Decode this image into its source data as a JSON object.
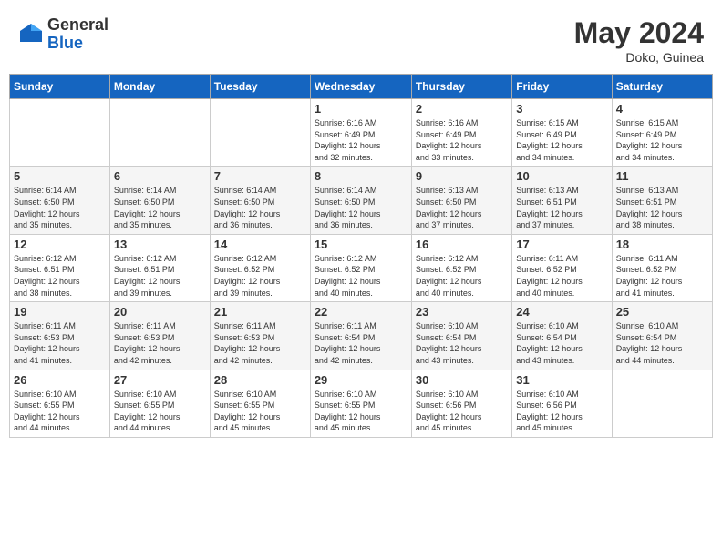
{
  "logo": {
    "general": "General",
    "blue": "Blue"
  },
  "title": {
    "month_year": "May 2024",
    "location": "Doko, Guinea"
  },
  "headers": [
    "Sunday",
    "Monday",
    "Tuesday",
    "Wednesday",
    "Thursday",
    "Friday",
    "Saturday"
  ],
  "weeks": [
    [
      {
        "day": "",
        "info": ""
      },
      {
        "day": "",
        "info": ""
      },
      {
        "day": "",
        "info": ""
      },
      {
        "day": "1",
        "info": "Sunrise: 6:16 AM\nSunset: 6:49 PM\nDaylight: 12 hours\nand 32 minutes."
      },
      {
        "day": "2",
        "info": "Sunrise: 6:16 AM\nSunset: 6:49 PM\nDaylight: 12 hours\nand 33 minutes."
      },
      {
        "day": "3",
        "info": "Sunrise: 6:15 AM\nSunset: 6:49 PM\nDaylight: 12 hours\nand 34 minutes."
      },
      {
        "day": "4",
        "info": "Sunrise: 6:15 AM\nSunset: 6:49 PM\nDaylight: 12 hours\nand 34 minutes."
      }
    ],
    [
      {
        "day": "5",
        "info": "Sunrise: 6:14 AM\nSunset: 6:50 PM\nDaylight: 12 hours\nand 35 minutes."
      },
      {
        "day": "6",
        "info": "Sunrise: 6:14 AM\nSunset: 6:50 PM\nDaylight: 12 hours\nand 35 minutes."
      },
      {
        "day": "7",
        "info": "Sunrise: 6:14 AM\nSunset: 6:50 PM\nDaylight: 12 hours\nand 36 minutes."
      },
      {
        "day": "8",
        "info": "Sunrise: 6:14 AM\nSunset: 6:50 PM\nDaylight: 12 hours\nand 36 minutes."
      },
      {
        "day": "9",
        "info": "Sunrise: 6:13 AM\nSunset: 6:50 PM\nDaylight: 12 hours\nand 37 minutes."
      },
      {
        "day": "10",
        "info": "Sunrise: 6:13 AM\nSunset: 6:51 PM\nDaylight: 12 hours\nand 37 minutes."
      },
      {
        "day": "11",
        "info": "Sunrise: 6:13 AM\nSunset: 6:51 PM\nDaylight: 12 hours\nand 38 minutes."
      }
    ],
    [
      {
        "day": "12",
        "info": "Sunrise: 6:12 AM\nSunset: 6:51 PM\nDaylight: 12 hours\nand 38 minutes."
      },
      {
        "day": "13",
        "info": "Sunrise: 6:12 AM\nSunset: 6:51 PM\nDaylight: 12 hours\nand 39 minutes."
      },
      {
        "day": "14",
        "info": "Sunrise: 6:12 AM\nSunset: 6:52 PM\nDaylight: 12 hours\nand 39 minutes."
      },
      {
        "day": "15",
        "info": "Sunrise: 6:12 AM\nSunset: 6:52 PM\nDaylight: 12 hours\nand 40 minutes."
      },
      {
        "day": "16",
        "info": "Sunrise: 6:12 AM\nSunset: 6:52 PM\nDaylight: 12 hours\nand 40 minutes."
      },
      {
        "day": "17",
        "info": "Sunrise: 6:11 AM\nSunset: 6:52 PM\nDaylight: 12 hours\nand 40 minutes."
      },
      {
        "day": "18",
        "info": "Sunrise: 6:11 AM\nSunset: 6:52 PM\nDaylight: 12 hours\nand 41 minutes."
      }
    ],
    [
      {
        "day": "19",
        "info": "Sunrise: 6:11 AM\nSunset: 6:53 PM\nDaylight: 12 hours\nand 41 minutes."
      },
      {
        "day": "20",
        "info": "Sunrise: 6:11 AM\nSunset: 6:53 PM\nDaylight: 12 hours\nand 42 minutes."
      },
      {
        "day": "21",
        "info": "Sunrise: 6:11 AM\nSunset: 6:53 PM\nDaylight: 12 hours\nand 42 minutes."
      },
      {
        "day": "22",
        "info": "Sunrise: 6:11 AM\nSunset: 6:54 PM\nDaylight: 12 hours\nand 42 minutes."
      },
      {
        "day": "23",
        "info": "Sunrise: 6:10 AM\nSunset: 6:54 PM\nDaylight: 12 hours\nand 43 minutes."
      },
      {
        "day": "24",
        "info": "Sunrise: 6:10 AM\nSunset: 6:54 PM\nDaylight: 12 hours\nand 43 minutes."
      },
      {
        "day": "25",
        "info": "Sunrise: 6:10 AM\nSunset: 6:54 PM\nDaylight: 12 hours\nand 44 minutes."
      }
    ],
    [
      {
        "day": "26",
        "info": "Sunrise: 6:10 AM\nSunset: 6:55 PM\nDaylight: 12 hours\nand 44 minutes."
      },
      {
        "day": "27",
        "info": "Sunrise: 6:10 AM\nSunset: 6:55 PM\nDaylight: 12 hours\nand 44 minutes."
      },
      {
        "day": "28",
        "info": "Sunrise: 6:10 AM\nSunset: 6:55 PM\nDaylight: 12 hours\nand 45 minutes."
      },
      {
        "day": "29",
        "info": "Sunrise: 6:10 AM\nSunset: 6:55 PM\nDaylight: 12 hours\nand 45 minutes."
      },
      {
        "day": "30",
        "info": "Sunrise: 6:10 AM\nSunset: 6:56 PM\nDaylight: 12 hours\nand 45 minutes."
      },
      {
        "day": "31",
        "info": "Sunrise: 6:10 AM\nSunset: 6:56 PM\nDaylight: 12 hours\nand 45 minutes."
      },
      {
        "day": "",
        "info": ""
      }
    ]
  ]
}
